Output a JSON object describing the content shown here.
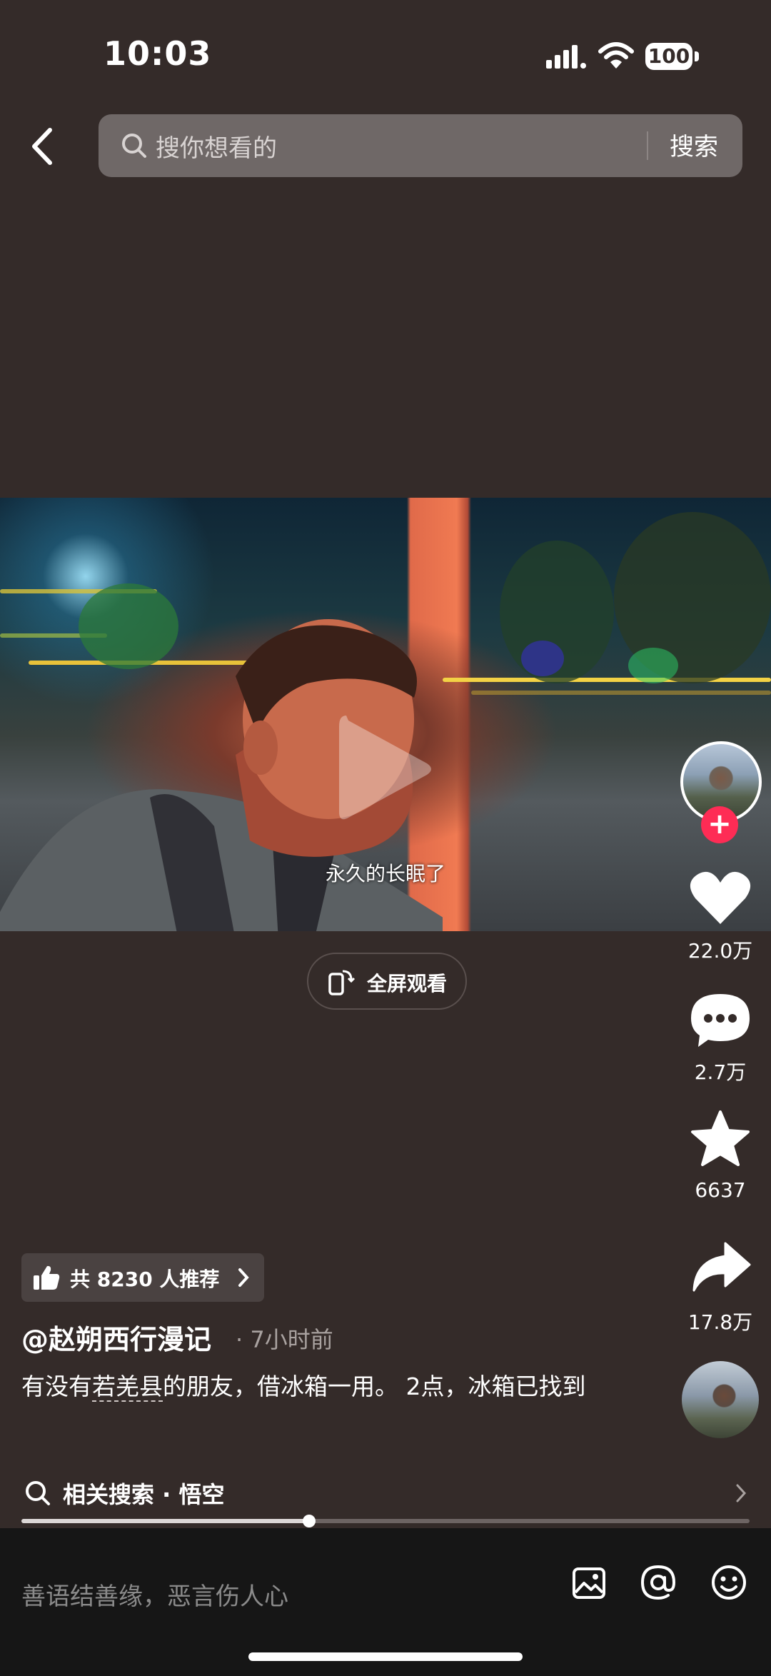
{
  "status_bar": {
    "time": "10:03",
    "battery": "100"
  },
  "header": {
    "search_placeholder": "搜你想看的",
    "search_button": "搜索"
  },
  "video": {
    "caption": "永久的长眠了",
    "fullscreen_label": "全屏观看"
  },
  "rail": {
    "likes": "22.0万",
    "comments": "2.7万",
    "favorites": "6637",
    "shares": "17.8万",
    "follow": "+"
  },
  "info": {
    "recommend": "共 8230 人推荐",
    "author": "@赵朔西行漫记",
    "time": "· 7小时前",
    "desc_before": "有没有",
    "desc_link": "若羌县",
    "desc_after": "的朋友，借冰箱一用。 2点，冰箱已找到"
  },
  "related": {
    "label": "相关搜索 · 悟空"
  },
  "progress": {
    "fraction": 0.395
  },
  "comment_bar": {
    "placeholder": "善语结善缘，恶言伤人心"
  },
  "icons": [
    "signal-icon",
    "wifi-icon",
    "back-icon",
    "search-icon",
    "play-icon",
    "fullscreen-icon",
    "heart-icon",
    "comment-icon",
    "star-icon",
    "share-icon",
    "thumb-up-icon",
    "chevron-right-icon",
    "image-icon",
    "at-icon",
    "emoji-icon"
  ],
  "colors": {
    "background": "#342b29",
    "follow": "#fe2c55",
    "search_bar": "#6f6867"
  }
}
